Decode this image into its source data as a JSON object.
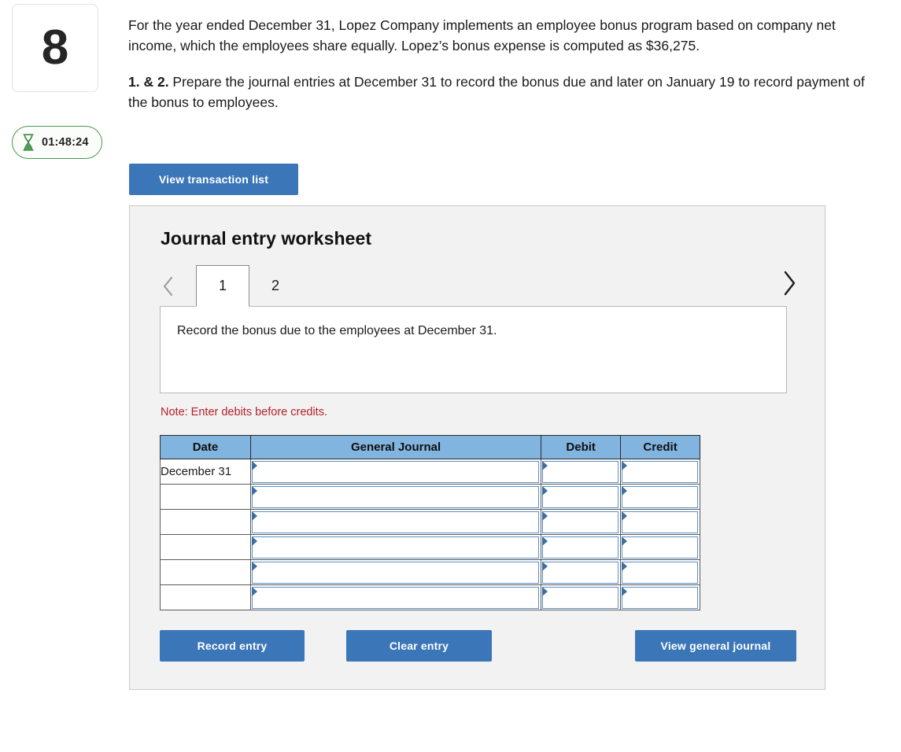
{
  "question": {
    "number": "8",
    "timer": "01:48:24",
    "timer_icon": "hourglass-icon",
    "paragraph_1": "For the year ended December 31, Lopez Company implements an employee bonus program based on company net income, which the employees share equally. Lopez’s bonus expense is computed as $36,275.",
    "requirement_label": "1. & 2.",
    "requirement_text": " Prepare the journal entries at December 31 to record the bonus due and later on January 19 to record payment of the bonus to employees."
  },
  "toolbar": {
    "view_transaction_list_label": "View transaction list"
  },
  "worksheet": {
    "title": "Journal entry worksheet",
    "tabs": [
      {
        "label": "1",
        "active": true
      },
      {
        "label": "2",
        "active": false
      }
    ],
    "nav": {
      "prev_icon": "chevron-left-icon",
      "next_icon": "chevron-right-icon"
    },
    "description": "Record the bonus due to the employees at December 31.",
    "note": "Note: Enter debits before credits.",
    "table": {
      "columns": [
        "Date",
        "General Journal",
        "Debit",
        "Credit"
      ],
      "rows": [
        {
          "date": "December 31",
          "general_journal": "",
          "debit": "",
          "credit": ""
        },
        {
          "date": "",
          "general_journal": "",
          "debit": "",
          "credit": ""
        },
        {
          "date": "",
          "general_journal": "",
          "debit": "",
          "credit": ""
        },
        {
          "date": "",
          "general_journal": "",
          "debit": "",
          "credit": ""
        },
        {
          "date": "",
          "general_journal": "",
          "debit": "",
          "credit": ""
        },
        {
          "date": "",
          "general_journal": "",
          "debit": "",
          "credit": ""
        }
      ]
    },
    "actions": {
      "record_entry_label": "Record entry",
      "clear_entry_label": "Clear entry",
      "view_general_journal_label": "View general journal"
    }
  },
  "colors": {
    "button_blue": "#3b76b8",
    "table_header_blue": "#82b4e0",
    "note_red": "#b5202a",
    "timer_green": "#4a9a52",
    "panel_gray": "#f2f2f2",
    "field_border_blue": "#5b8fc4"
  }
}
